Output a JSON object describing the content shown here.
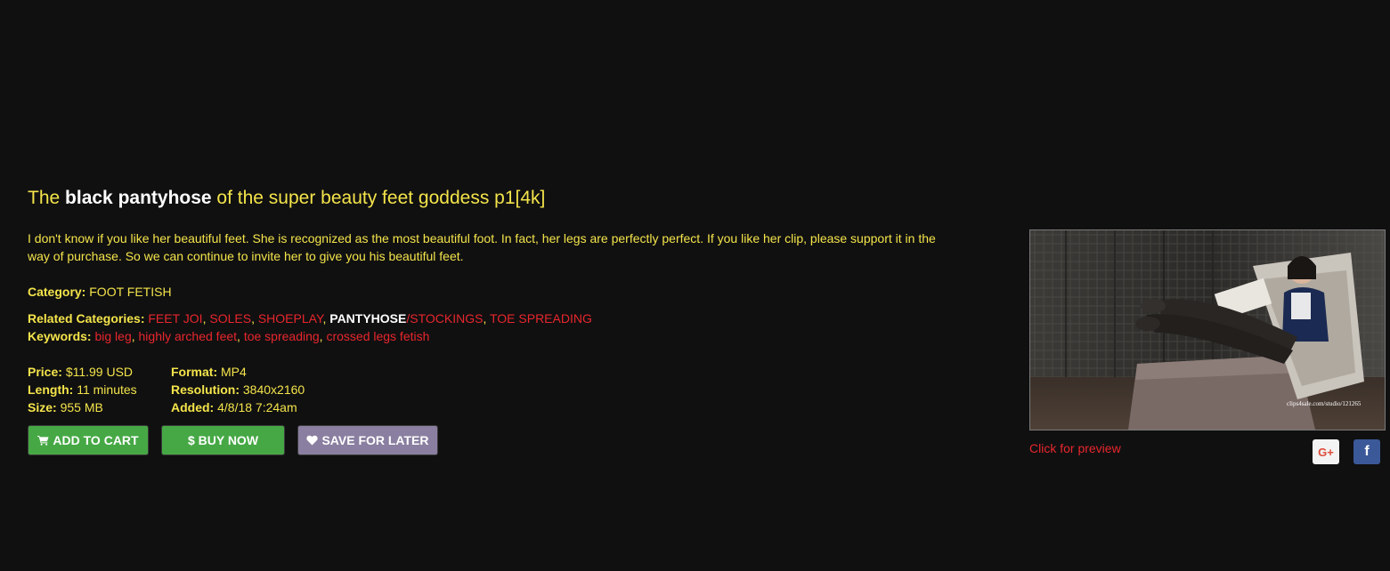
{
  "product": {
    "title_prefix": "The ",
    "title_highlight": "black pantyhose",
    "title_suffix": " of the super beauty feet goddess p1[4k]",
    "description": "I don't know if you like her beautiful feet. She is recognized as the most beautiful foot. In fact, her legs are perfectly perfect. If you like her clip, please support it in the way of purchase. So we can continue to invite her to give you his beautiful feet.",
    "category_label": "Category:",
    "category_value": "FOOT FETISH",
    "related_label": "Related Categories:",
    "related": [
      "FEET JOI",
      "SOLES",
      "SHOEPLAY"
    ],
    "related_white": "PANTYHOSE",
    "related_after_white": "/STOCKINGS",
    "related_last": "TOE SPREADING",
    "keywords_label": "Keywords:",
    "keywords": [
      "big leg",
      "highly arched feet",
      "toe spreading",
      "crossed legs fetish"
    ],
    "comma": ", "
  },
  "details": {
    "price_label": "Price:",
    "price_value": "$11.99 USD",
    "length_label": "Length:",
    "length_value": "11 minutes",
    "size_label": "Size:",
    "size_value": "955 MB",
    "format_label": "Format:",
    "format_value": "MP4",
    "resolution_label": "Resolution:",
    "resolution_value": "3840x2160",
    "added_label": "Added:",
    "added_value": "4/8/18 7:24am"
  },
  "buttons": {
    "add_to_cart": "ADD TO CART",
    "buy_now": "$ BUY NOW",
    "save_for_later": "SAVE FOR LATER"
  },
  "preview": {
    "link_text": "Click for preview",
    "watermark": "clips4sale.com/studio/121265"
  },
  "social": {
    "google_label": "G+",
    "facebook_label": "f"
  },
  "icons": [
    "shopping-cart-icon",
    "heart-icon",
    "google-plus-icon",
    "facebook-icon"
  ],
  "colors": {
    "background": "#101011",
    "title_yellow": "#f4e44a",
    "link_red": "#e8262c",
    "button_green": "#46a845",
    "button_purple": "#8a7fa0",
    "facebook_blue": "#3b5998"
  }
}
